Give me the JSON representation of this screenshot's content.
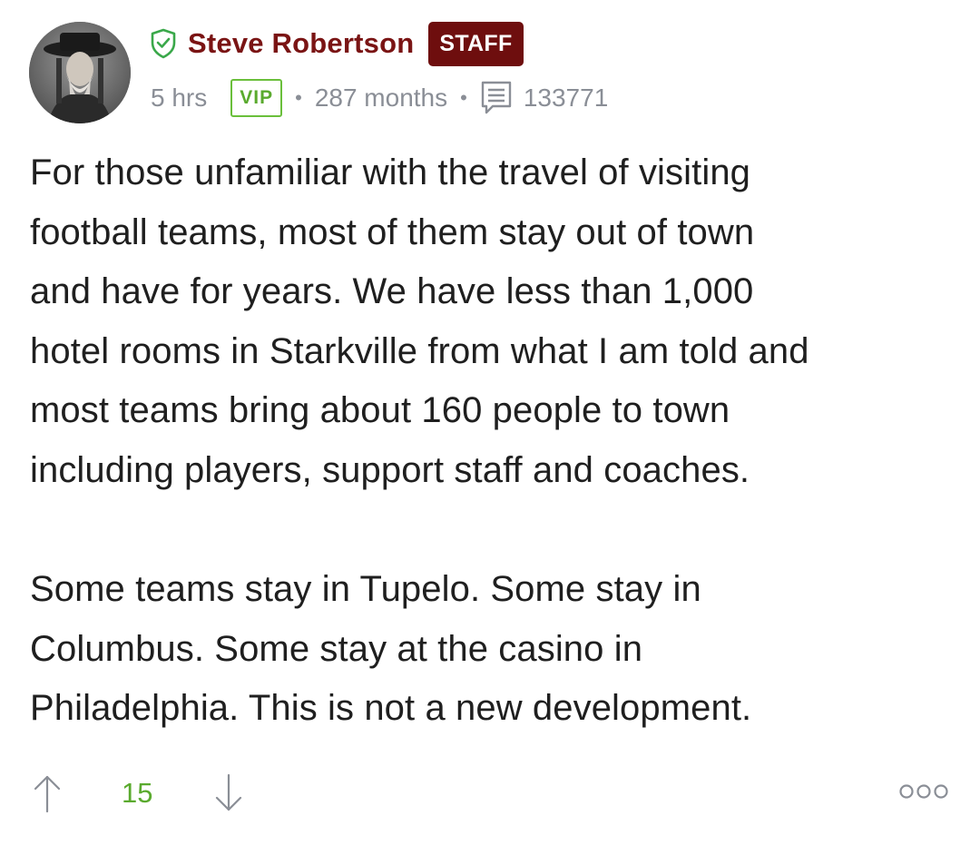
{
  "post": {
    "author": {
      "name": "Steve Robertson",
      "badge": "STAFF",
      "avatar_icon": "avatar-photo",
      "name_color": "#7a1414",
      "badge_color": "#6e0e0e"
    },
    "meta": {
      "time": "5 hrs",
      "vip_label": "VIP",
      "membership": "287 months",
      "post_count": "133771",
      "vip_color": "#5aaa2e"
    },
    "body": {
      "paragraph_1": "For those unfamiliar with the travel of visiting\nfootball teams, most of them stay out of town\nand have for years. We have less than 1,000\nhotel rooms in Starkville from what I am told and\nmost teams bring about 160 people to town\nincluding players, support staff and coaches.",
      "paragraph_2": "Some teams stay in Tupelo. Some stay in\nColumbus. Some stay at the casino in\nPhiladelphia. This is not a new development."
    },
    "footer": {
      "vote_count": "15",
      "upvote_icon": "arrow-up-icon",
      "downvote_icon": "arrow-down-icon",
      "more_icon": "more-options-icon"
    }
  }
}
